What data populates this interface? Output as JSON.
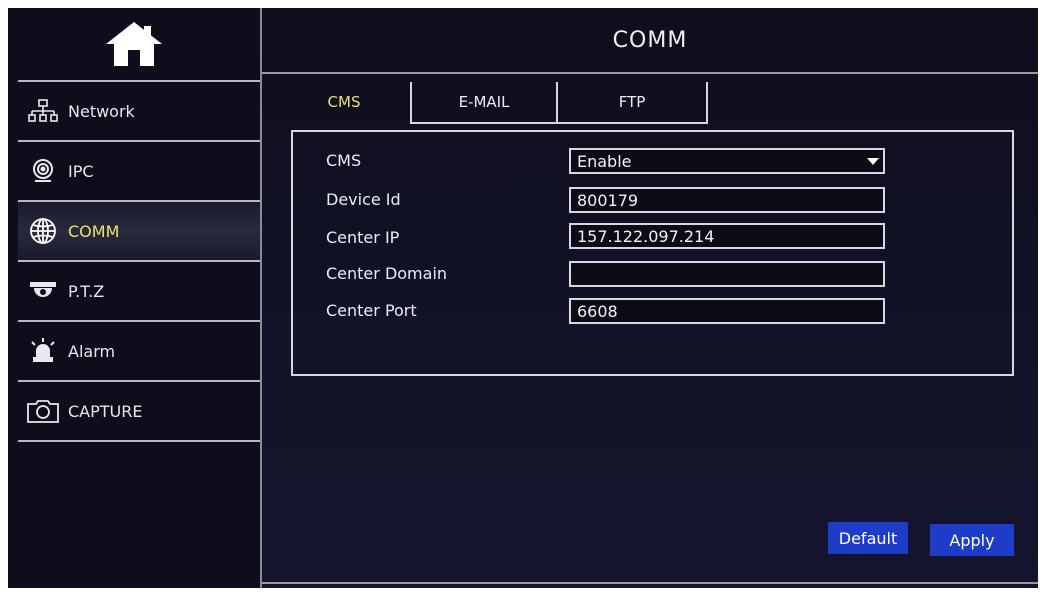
{
  "header": {
    "title": "COMM"
  },
  "sidebar": {
    "items": [
      {
        "label": "Network",
        "icon": "network-icon"
      },
      {
        "label": "IPC",
        "icon": "camera-lens-icon"
      },
      {
        "label": "COMM",
        "icon": "globe-icon",
        "active": true
      },
      {
        "label": "P.T.Z",
        "icon": "dome-camera-icon"
      },
      {
        "label": "Alarm",
        "icon": "alarm-siren-icon"
      },
      {
        "label": "CAPTURE",
        "icon": "capture-camera-icon"
      }
    ]
  },
  "tabs": [
    {
      "label": "CMS",
      "active": true
    },
    {
      "label": "E-MAIL"
    },
    {
      "label": "FTP"
    }
  ],
  "form": {
    "cms_label": "CMS",
    "cms_value": "Enable",
    "device_id_label": "Device Id",
    "device_id_value": "800179",
    "center_ip_label": "Center IP",
    "center_ip_value": "157.122.097.214",
    "center_domain_label": "Center Domain",
    "center_domain_value": "",
    "center_port_label": "Center Port",
    "center_port_value": "6608"
  },
  "buttons": {
    "default_label": "Default",
    "apply_label": "Apply"
  },
  "colors": {
    "accent": "#e8e26a",
    "button": "#1f3cc9",
    "background": "#121228"
  }
}
